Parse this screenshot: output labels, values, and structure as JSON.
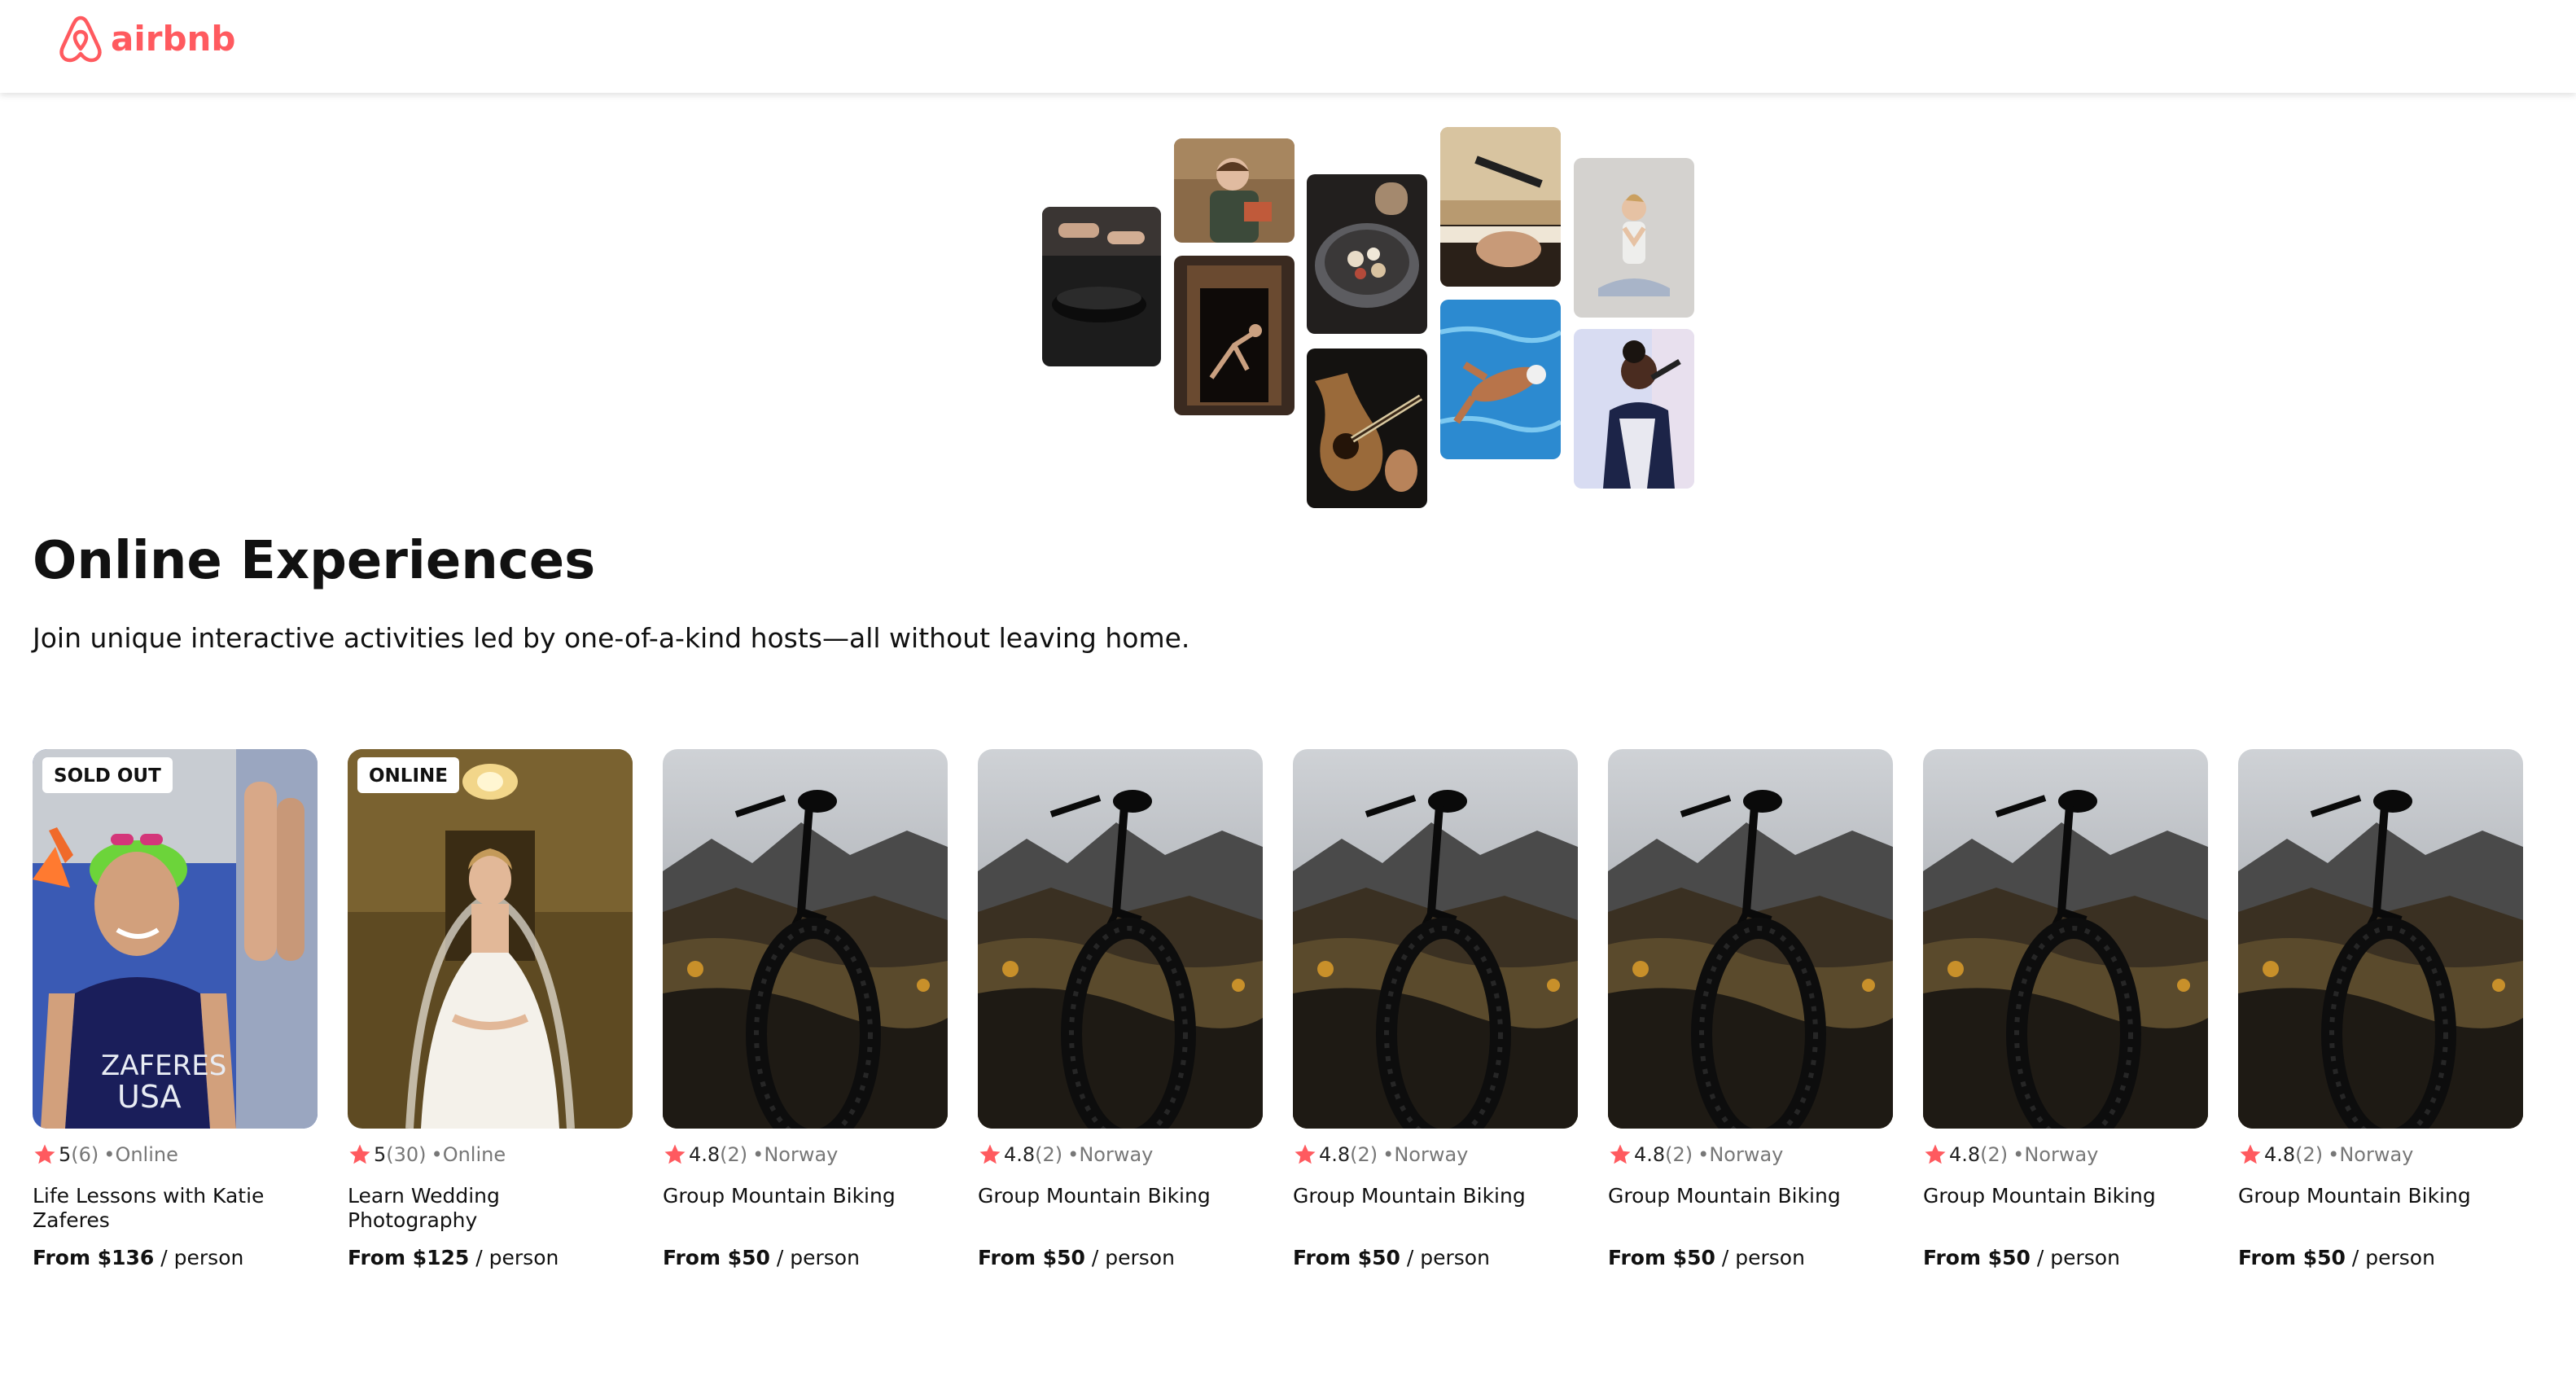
{
  "brand": {
    "name": "airbnb",
    "color": "#FF5A5F",
    "icon": "airbnb-belo-icon"
  },
  "hero": {
    "photos": [
      {
        "name": "cooking-photo"
      },
      {
        "name": "woman-reading-photo"
      },
      {
        "name": "dancer-doorway-photo"
      },
      {
        "name": "food-bowl-photo"
      },
      {
        "name": "guitar-photo"
      },
      {
        "name": "piano-microphone-photo"
      },
      {
        "name": "swimmer-photo"
      },
      {
        "name": "yoga-photo"
      },
      {
        "name": "singer-photo"
      }
    ]
  },
  "page": {
    "title": "Online Experiences",
    "subtitle": "Join unique interactive activities led by one-of-a-kind hosts—all without leaving home."
  },
  "icons": {
    "star": "star-icon",
    "star_color": "#FF5A5F"
  },
  "cards": [
    {
      "badge": "SOLD OUT",
      "rating": "5",
      "count": "(6)",
      "location": "•Online",
      "title": "Life Lessons with Katie Zaferes",
      "price_from": "From $136",
      "price_unit": " / person",
      "image": "swimmer-portrait"
    },
    {
      "badge": "ONLINE",
      "rating": "5",
      "count": "(30)",
      "location": "•Online",
      "title": "Learn Wedding Photography",
      "price_from": "From $125",
      "price_unit": " / person",
      "image": "bride-portrait"
    },
    {
      "badge": "",
      "rating": "4.8",
      "count": "(2)",
      "location": "•Norway",
      "title": "Group Mountain Biking",
      "price_from": "From $50",
      "price_unit": " / person",
      "image": "mountain-bike"
    },
    {
      "badge": "",
      "rating": "4.8",
      "count": "(2)",
      "location": "•Norway",
      "title": "Group Mountain Biking",
      "price_from": "From $50",
      "price_unit": " / person",
      "image": "mountain-bike"
    },
    {
      "badge": "",
      "rating": "4.8",
      "count": "(2)",
      "location": "•Norway",
      "title": "Group Mountain Biking",
      "price_from": "From $50",
      "price_unit": " / person",
      "image": "mountain-bike"
    },
    {
      "badge": "",
      "rating": "4.8",
      "count": "(2)",
      "location": "•Norway",
      "title": "Group Mountain Biking",
      "price_from": "From $50",
      "price_unit": " / person",
      "image": "mountain-bike"
    },
    {
      "badge": "",
      "rating": "4.8",
      "count": "(2)",
      "location": "•Norway",
      "title": "Group Mountain Biking",
      "price_from": "From $50",
      "price_unit": " / person",
      "image": "mountain-bike"
    },
    {
      "badge": "",
      "rating": "4.8",
      "count": "(2)",
      "location": "•Norway",
      "title": "Group Mountain Biking",
      "price_from": "From $50",
      "price_unit": " / person",
      "image": "mountain-bike"
    }
  ]
}
